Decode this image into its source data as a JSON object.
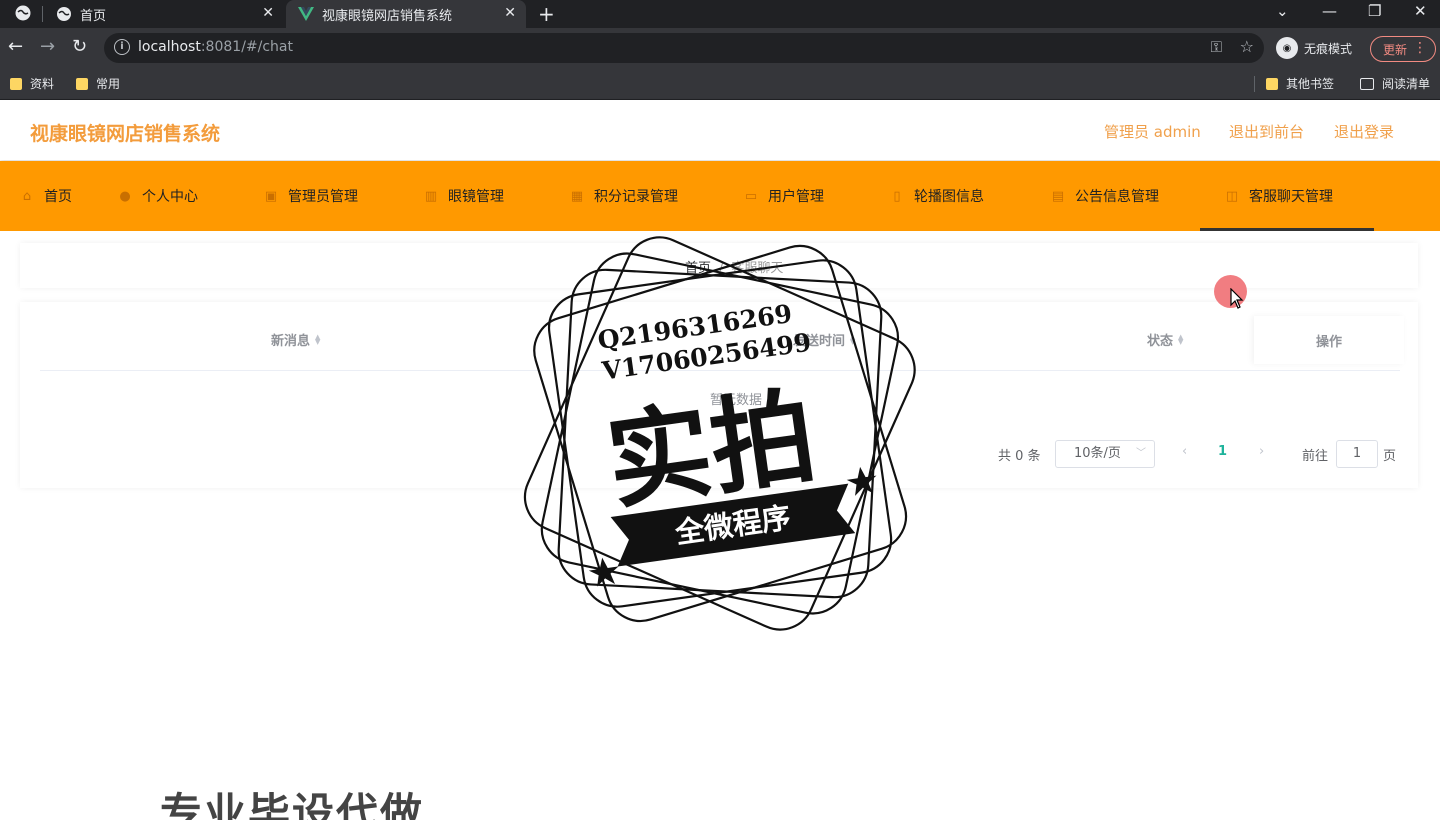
{
  "browser": {
    "tabs": [
      {
        "title": "首页",
        "active": false
      },
      {
        "title": "视康眼镜网店销售系统",
        "active": true
      }
    ],
    "url_host": "localhost",
    "url_rest": ":8081/#/chat",
    "incognito_label": "无痕模式",
    "update_label": "更新",
    "bookmarks": [
      "资料",
      "常用"
    ],
    "bookmarks_right": [
      "其他书签",
      "阅读清单"
    ]
  },
  "header": {
    "site_title": "视康眼镜网店销售系统",
    "admin_label": "管理员 admin",
    "back_front_label": "退出到前台",
    "logout_label": "退出登录"
  },
  "nav": {
    "items": [
      {
        "label": "首页",
        "icon": "home-icon"
      },
      {
        "label": "个人中心",
        "icon": "user-icon"
      },
      {
        "label": "管理员管理",
        "icon": "admin-icon"
      },
      {
        "label": "眼镜管理",
        "icon": "glasses-icon"
      },
      {
        "label": "积分记录管理",
        "icon": "points-icon"
      },
      {
        "label": "用户管理",
        "icon": "users-icon"
      },
      {
        "label": "轮播图信息",
        "icon": "carousel-icon"
      },
      {
        "label": "公告信息管理",
        "icon": "notice-icon"
      },
      {
        "label": "客服聊天管理",
        "icon": "chat-icon"
      }
    ],
    "active_index": 8
  },
  "breadcrumb": {
    "home": "首页",
    "current": "客服聊天"
  },
  "table": {
    "columns": [
      "新消息",
      "发送时间",
      "状态"
    ],
    "action_column": "操作",
    "empty_text": "暂无数据"
  },
  "pagination": {
    "total_label": "共 0 条",
    "page_size": "10条/页",
    "current_page": "1",
    "goto_label": "前往",
    "goto_value": "1",
    "page_suffix": "页"
  },
  "watermark": {
    "line1": "Q2196316269",
    "line2": "V17060256499",
    "big": "实拍",
    "ribbon": "全微程序"
  },
  "bottom_overlay": "专业毕设代做"
}
